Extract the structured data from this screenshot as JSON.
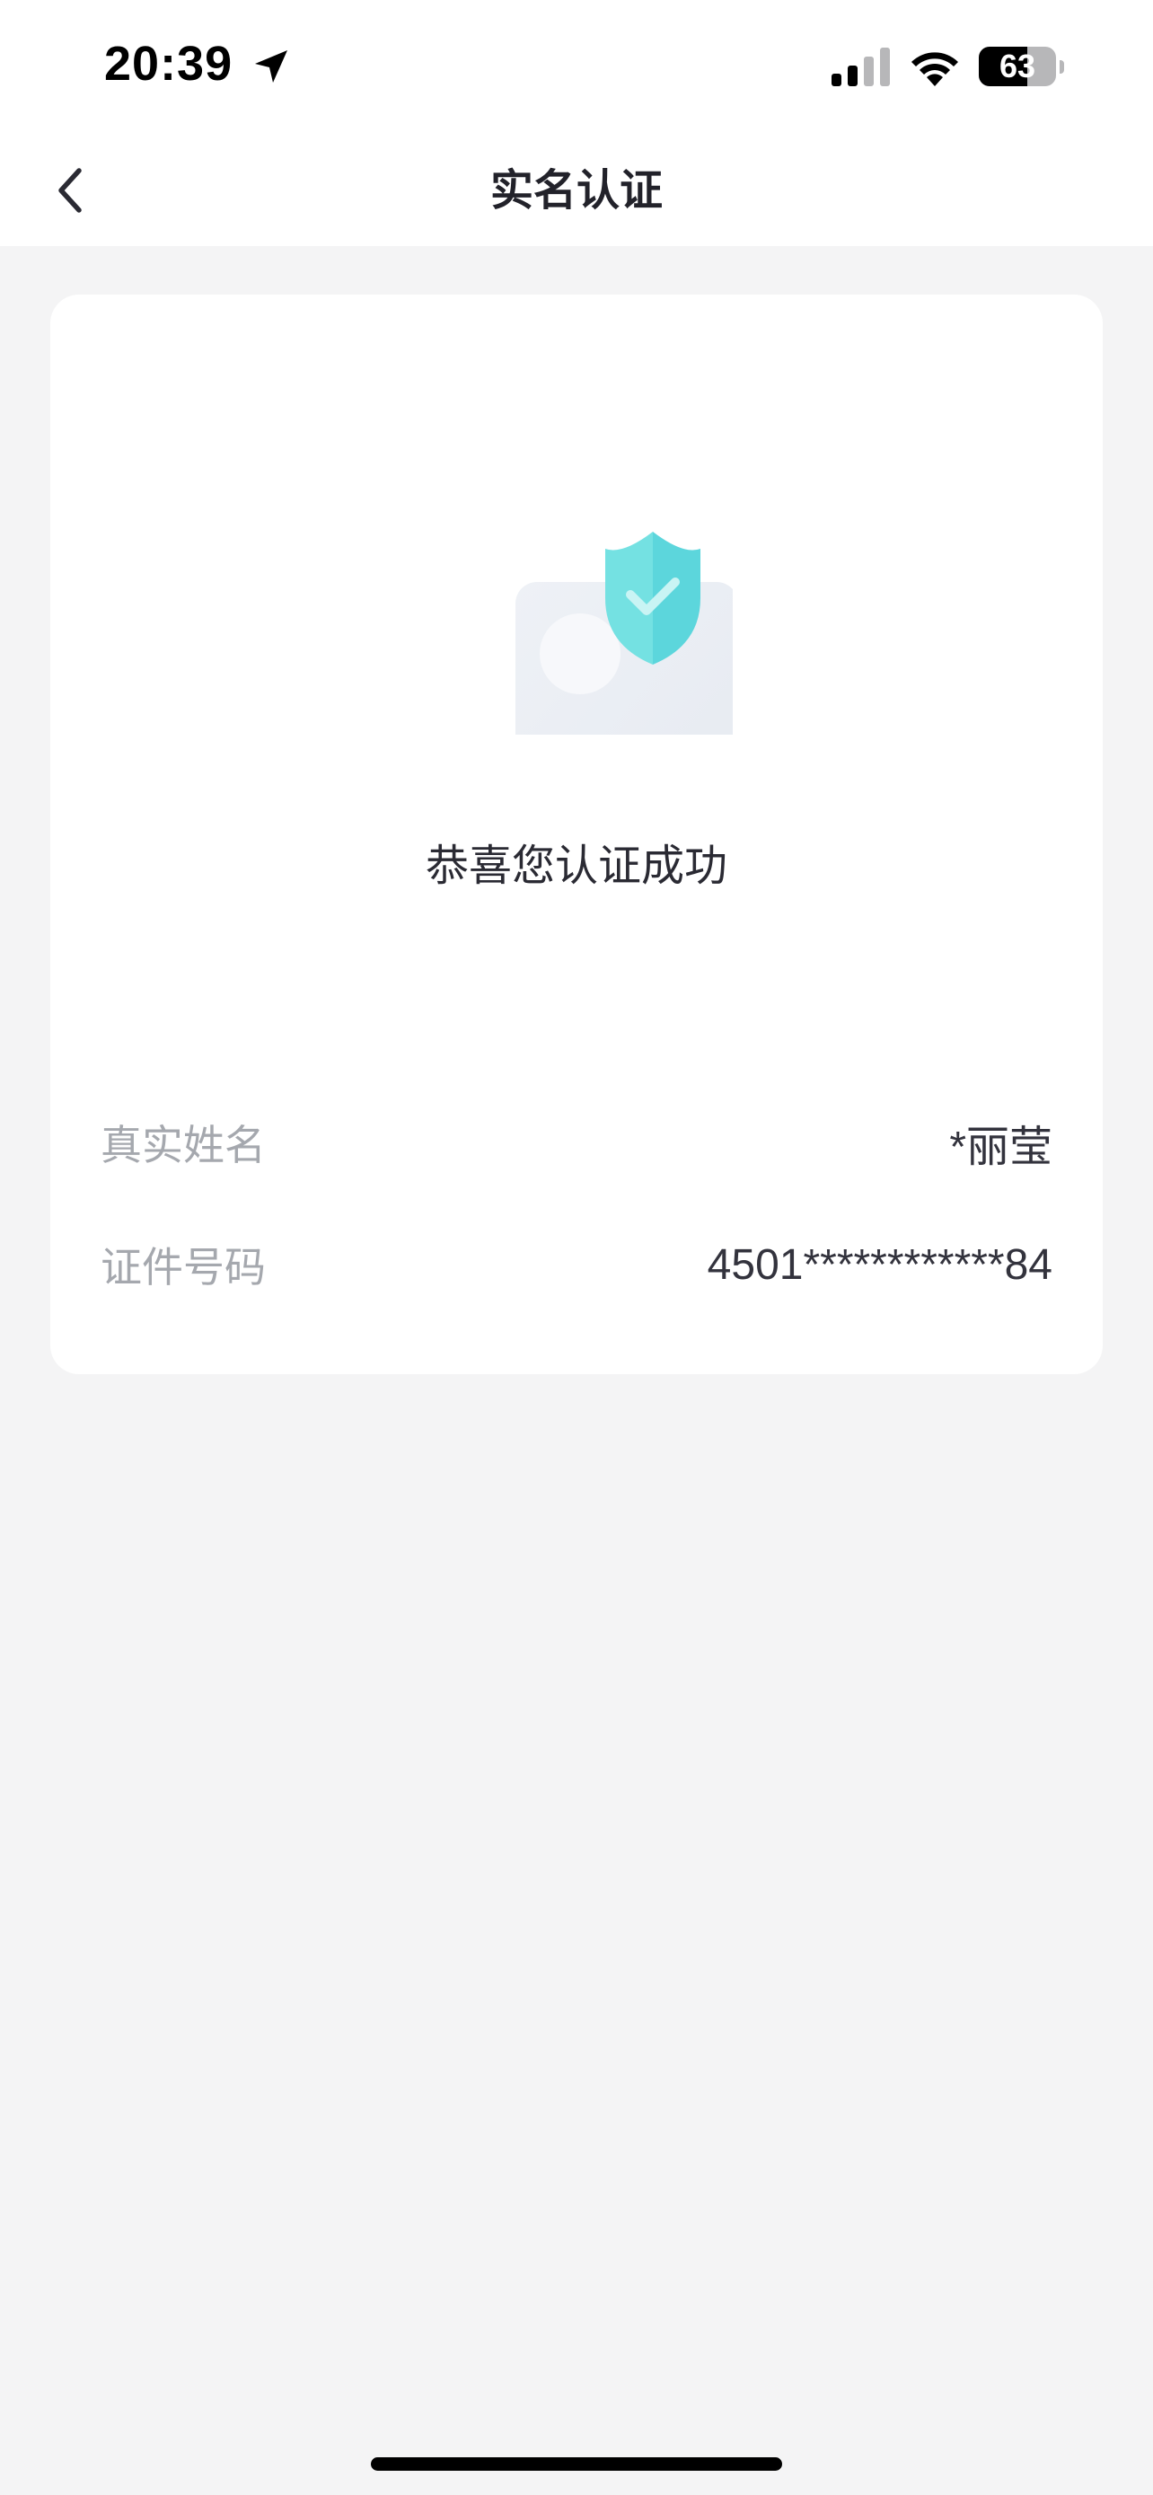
{
  "status_bar": {
    "time": "20:39",
    "battery_level": "63",
    "battery_fraction": 0.63
  },
  "nav": {
    "title": "实名认证",
    "back_icon": "chevron-left-icon"
  },
  "card": {
    "illustration_icon": "id-card-shield-check-icon",
    "success_message": "恭喜您认证成功",
    "rows": [
      {
        "label": "真实姓名",
        "value": "*丽莹"
      },
      {
        "label": "证件号码",
        "value": "4501************84"
      }
    ]
  },
  "colors": {
    "background": "#f4f4f5",
    "card": "#ffffff",
    "shield_accent": "#5ad8de",
    "label_gray": "#a5a8ae",
    "value_dark": "#33333d"
  }
}
